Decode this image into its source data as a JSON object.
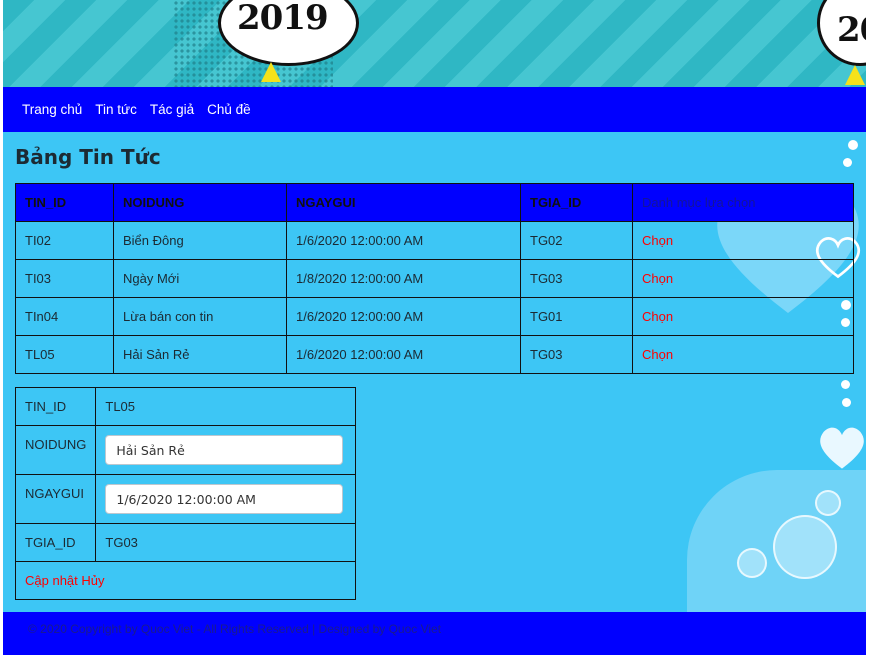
{
  "banner": {
    "year_text": "2019",
    "year_text_right": "20"
  },
  "nav": {
    "items": [
      "Trang chủ",
      "Tin tức",
      "Tác giả",
      "Chủ đề"
    ]
  },
  "page_title": "Bảng Tin Tức",
  "news_table": {
    "headers": [
      "TIN_ID",
      "NOIDUNG",
      "NGAYGUI",
      "TGIA_ID",
      "Danh mục lựa chọn"
    ],
    "rows": [
      {
        "tin_id": "TI02",
        "noidung": "Biển Đông",
        "ngaygui": "1/6/2020 12:00:00 AM",
        "tgia_id": "TG02",
        "action": "Chọn"
      },
      {
        "tin_id": "TI03",
        "noidung": "Ngày Mới",
        "ngaygui": "1/8/2020 12:00:00 AM",
        "tgia_id": "TG03",
        "action": "Chọn"
      },
      {
        "tin_id": "TIn04",
        "noidung": "Lừa bán con tin",
        "ngaygui": "1/6/2020 12:00:00 AM",
        "tgia_id": "TG01",
        "action": "Chọn"
      },
      {
        "tin_id": "TL05",
        "noidung": "Hải Sản Rẻ",
        "ngaygui": "1/6/2020 12:00:00 AM",
        "tgia_id": "TG03",
        "action": "Chọn"
      }
    ]
  },
  "detail": {
    "tin_id_label": "TIN_ID",
    "tin_id_value": "TL05",
    "noidung_label": "NOIDUNG",
    "noidung_value": "Hải Sản Rẻ",
    "ngaygui_label": "NGAYGUI",
    "ngaygui_value": "1/6/2020 12:00:00 AM",
    "tgia_id_label": "TGIA_ID",
    "tgia_id_value": "TG03",
    "update_label": "Cập nhật",
    "cancel_label": "Hủy"
  },
  "footer": {
    "text": "© 2020 Copyright by Quoc Viet - All Rights Reserved | Designed by Quoc Viet"
  },
  "colors": {
    "nav_bg": "#0000ff",
    "page_bg": "#3dc6f5",
    "link": "#ff0000"
  }
}
